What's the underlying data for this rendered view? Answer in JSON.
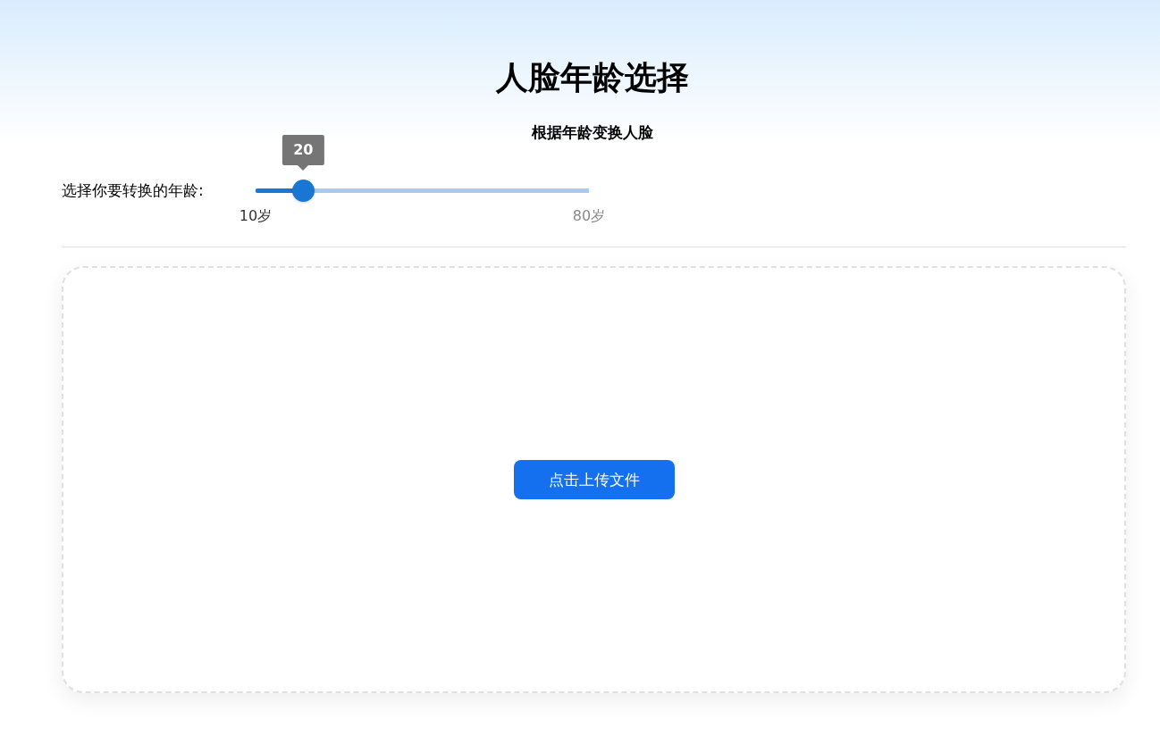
{
  "title": "人脸年龄选择",
  "subtitle": "根据年龄变换人脸",
  "age_slider": {
    "label": "选择你要转换的年龄:",
    "level": 0.143,
    "tooltip": "20",
    "min_label": "10岁",
    "max_label": "80岁"
  },
  "upload": {
    "button": "点击上传文件"
  }
}
